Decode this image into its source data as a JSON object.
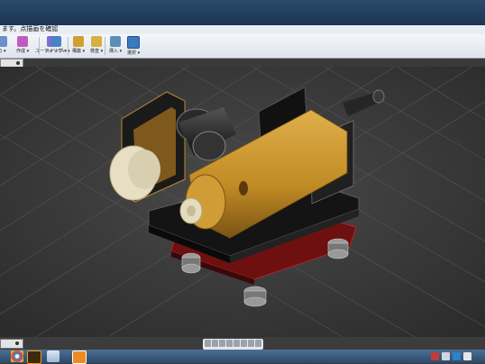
{
  "titlebar": {
    "document_tab": "ます。点描画を確認"
  },
  "ribbon": {
    "groups": [
      {
        "name": "sketch",
        "label": "の ▾"
      },
      {
        "name": "create",
        "label": "作成 ▾"
      },
      {
        "name": "modify",
        "label": "ユーティリティ ▾"
      },
      {
        "name": "assemble",
        "label": "スナップ ▾"
      },
      {
        "name": "construct",
        "label": "構築 ▾"
      },
      {
        "name": "inspect",
        "label": "検査 ▾"
      },
      {
        "name": "insert",
        "label": "挿入 ▾"
      },
      {
        "name": "select",
        "label": "選択 ▾"
      }
    ]
  },
  "taskbar": {
    "apps": [
      "chrome",
      "illustrator",
      "gallery",
      "fusion360"
    ]
  },
  "colors": {
    "viewport_bg": "#3a3a3a",
    "grid": "#505050",
    "cylinder": "#c8922a",
    "base_plate": "#151515",
    "red_plate": "#7a1414",
    "accent": "#2d82c7"
  }
}
